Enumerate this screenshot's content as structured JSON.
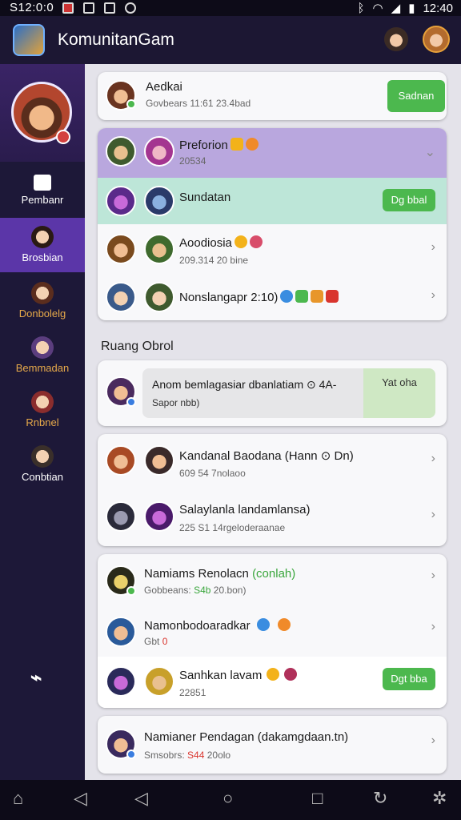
{
  "status_bar": {
    "time_left": "S12:0:0",
    "time_right": "12:40"
  },
  "app": {
    "title": "KomunitanGam"
  },
  "sidebar": {
    "items": [
      {
        "label": "Pembanr"
      },
      {
        "label": "Brosbian"
      },
      {
        "label": "Donbolelg"
      },
      {
        "label": "Bemmadan"
      },
      {
        "label": "Rnbnel"
      },
      {
        "label": "Conbtian"
      }
    ]
  },
  "cards": {
    "top": {
      "name": "Aedkai",
      "sub": "Govbears 11:61 23.4bad",
      "button": "Sadnan"
    },
    "group": {
      "name": "Preforion",
      "sub": "20534"
    },
    "highlight": {
      "name": "Sundatan",
      "button": "Dg bbal"
    },
    "list1": [
      {
        "name": "Aoodiosia",
        "sub": "209.314 20 bine"
      },
      {
        "name": "Nonslangapr 2:10)"
      }
    ]
  },
  "section_title": "Ruang Obrol",
  "chat_preview": {
    "text": "Anom bemlagasiar dbanlatiam ⊙ 4A-",
    "sub": "Sapor nbb)",
    "button": "Yat oha"
  },
  "list2": [
    {
      "name": "Kandanal Baodana (Hann ⊙ Dn)",
      "sub": "609 54 7nolaoo"
    },
    {
      "name": "Salaylanla landamlansa)",
      "sub": "225 S1 14rgeloderaanae"
    }
  ],
  "list3": [
    {
      "name": "Namiams Renolacn",
      "tag": "(conlah)",
      "sub_prefix": "Gobbeans:",
      "sub_value": "S4b",
      "sub_suffix": "20.bon)"
    },
    {
      "name": "Namonbodoaradkar",
      "sub_prefix": "Gbt",
      "sub_value": "0"
    },
    {
      "name": "Sanhkan lavam",
      "sub": "22851",
      "button": "Dgt bba"
    }
  ],
  "list4": [
    {
      "name": "Namianer Pendagan (dakamgdaan.tn)",
      "sub_prefix": "Smsobrs:",
      "sub_value": "S44",
      "sub_suffix": "20olo"
    }
  ],
  "colors": {
    "accent": "#5b36a8",
    "green": "#4cb84e",
    "group_bg": "#b9a7de",
    "highlight_bg": "#bde6d8"
  }
}
